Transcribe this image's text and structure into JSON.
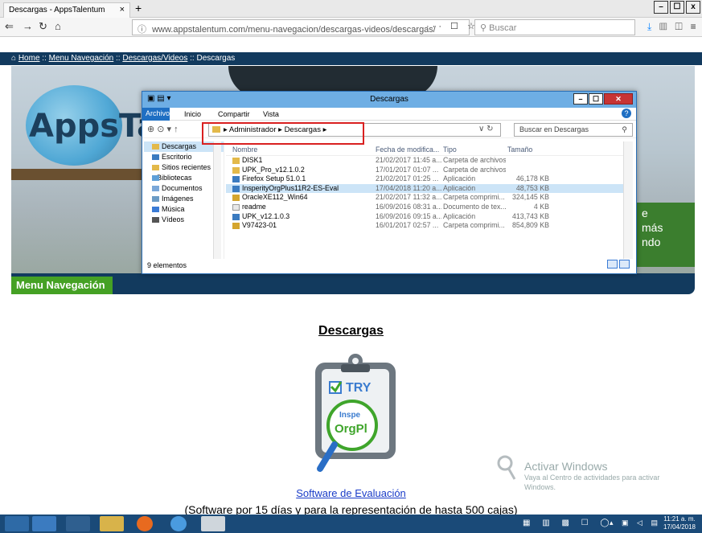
{
  "browser": {
    "tab_title": "Descargas - AppsTalentum",
    "tab_close": "×",
    "new_tab": "+",
    "url": "www.appstalentum.com/menu-navegacion/descargas-videos/descargas/",
    "url_tools": "··· ☐ ☆",
    "search_placeholder": "Buscar",
    "window_controls": [
      "–",
      "☐",
      "x"
    ]
  },
  "page": {
    "breadcrumb": {
      "home": "Home",
      "sep": "::",
      "items": [
        "Menu Navegación",
        "Descargas/Videos",
        "Descargas"
      ]
    },
    "logo_text": "AppsTa",
    "green_box_text": [
      "e",
      "más",
      "ndo"
    ],
    "menu_tab": "Menu Navegación",
    "title": "Descargas",
    "badge": {
      "try": "TRY",
      "inspe": "Inspe",
      "orgpl": "OrgPl"
    },
    "eval_link": "Software de Evaluación",
    "subtext": "(Software por 15 días y para la representación de hasta 500 cajas)",
    "activate": {
      "title": "Activar Windows",
      "line": "Vaya al Centro de actividades para activar",
      "line2": "Windows."
    }
  },
  "explorer": {
    "title": "Descargas",
    "ribbon_tabs": [
      "Archivo",
      "Inicio",
      "Compartir",
      "Vista"
    ],
    "help": "?",
    "path": [
      "Administrador",
      "Descargas"
    ],
    "search_placeholder": "Buscar en Descargas",
    "nav_items": [
      {
        "label": "Descargas",
        "selected": true
      },
      {
        "label": "Escritorio"
      },
      {
        "label": "Sitios recientes"
      },
      {
        "label": "Bibliotecas"
      },
      {
        "label": "Documentos"
      },
      {
        "label": "Imágenes"
      },
      {
        "label": "Música"
      },
      {
        "label": "Vídeos"
      }
    ],
    "columns": {
      "name": "Nombre",
      "date": "Fecha de modifica...",
      "type": "Tipo",
      "size": "Tamaño"
    },
    "files": [
      {
        "name": "DISK1",
        "date": "21/02/2017 11:45 a...",
        "type": "Carpeta de archivos",
        "size": "",
        "icon": "folder-icon"
      },
      {
        "name": "UPK_Pro_v12.1.0.2",
        "date": "17/01/2017 01:07 ...",
        "type": "Carpeta de archivos",
        "size": "",
        "icon": "folder-icon"
      },
      {
        "name": "Firefox Setup 51.0.1",
        "date": "21/02/2017 01:25 ...",
        "type": "Aplicación",
        "size": "46,178 KB",
        "icon": "app-icon"
      },
      {
        "name": "InsperityOrgPlus11R2-ES-Eval",
        "date": "17/04/2018 11:20 a...",
        "type": "Aplicación",
        "size": "48,753 KB",
        "icon": "app-icon",
        "selected": true
      },
      {
        "name": "OracleXE112_Win64",
        "date": "21/02/2017 11:32 a...",
        "type": "Carpeta comprimi...",
        "size": "324,145 KB",
        "icon": "zip-icon"
      },
      {
        "name": "readme",
        "date": "16/09/2016 08:31 a...",
        "type": "Documento de tex...",
        "size": "4 KB",
        "icon": "text-file-icon"
      },
      {
        "name": "UPK_v12.1.0.3",
        "date": "16/09/2016 09:15 a...",
        "type": "Aplicación",
        "size": "413,743 KB",
        "icon": "app-icon"
      },
      {
        "name": "V97423-01",
        "date": "16/01/2017 02:57 ...",
        "type": "Carpeta comprimi...",
        "size": "854,809 KB",
        "icon": "zip-icon"
      }
    ],
    "status": "9 elementos"
  },
  "taskbar": {
    "clock_time": "11:21 a. m.",
    "clock_date": "17/04/2018"
  }
}
